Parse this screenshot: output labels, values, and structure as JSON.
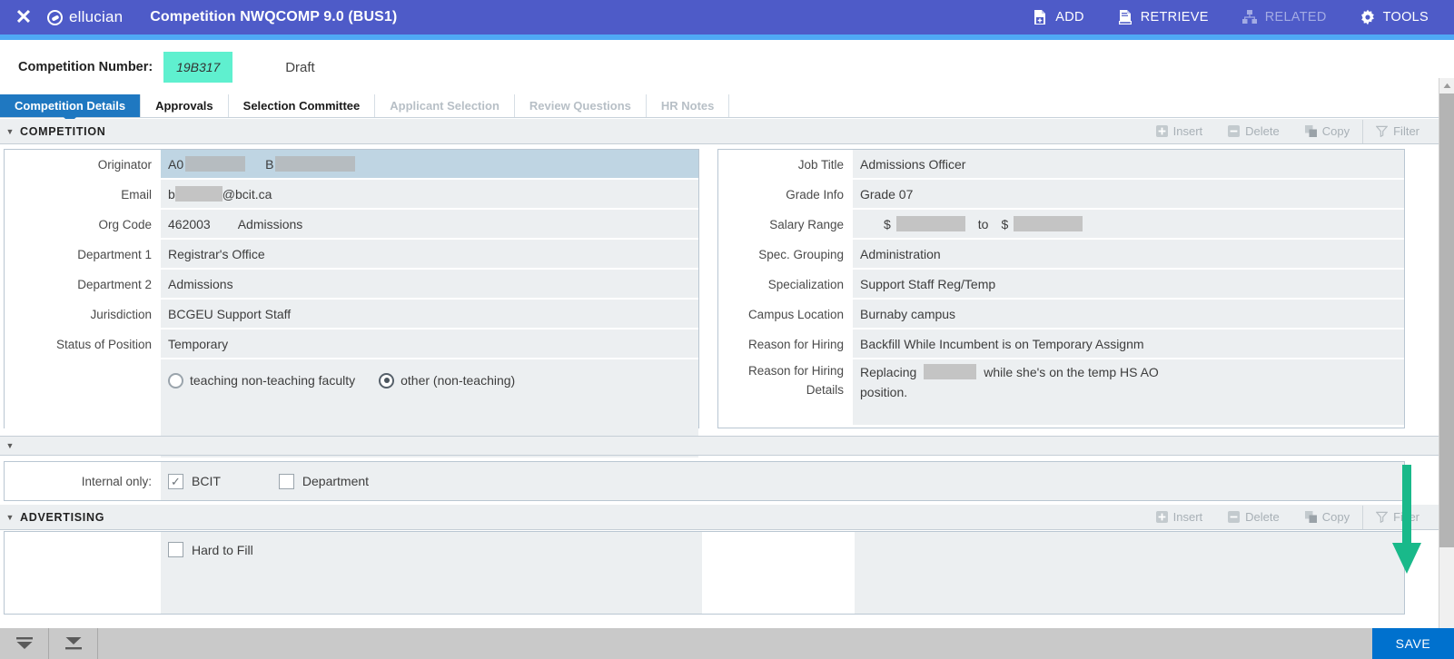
{
  "header": {
    "close_icon": "close-icon",
    "brand": "ellucian",
    "title": "Competition NWQCOMP 9.0 (BUS1)",
    "actions": [
      {
        "label": "ADD",
        "icon": "add-document-icon",
        "disabled": false
      },
      {
        "label": "RETRIEVE",
        "icon": "retrieve-document-icon",
        "disabled": false
      },
      {
        "label": "RELATED",
        "icon": "related-hierarchy-icon",
        "disabled": true
      },
      {
        "label": "TOOLS",
        "icon": "gear-icon",
        "disabled": false
      }
    ],
    "accent_purple": "#4e5bc8",
    "accent_blue": "#4fa8f5"
  },
  "key_block": {
    "label": "Competition Number:",
    "value": "19B317",
    "value_bg": "#5ff0cf",
    "status": "Draft"
  },
  "tabs": [
    {
      "label": "Competition Details",
      "active": true,
      "disabled": false
    },
    {
      "label": "Approvals",
      "active": false,
      "disabled": false
    },
    {
      "label": "Selection Committee",
      "active": false,
      "disabled": false
    },
    {
      "label": "Applicant Selection",
      "active": false,
      "disabled": true
    },
    {
      "label": "Review Questions",
      "active": false,
      "disabled": true
    },
    {
      "label": "HR Notes",
      "active": false,
      "disabled": true
    }
  ],
  "section_tools": {
    "insert": "Insert",
    "delete": "Delete",
    "copy": "Copy",
    "filter": "Filter"
  },
  "competition": {
    "section_title": "COMPETITION",
    "left_fields": [
      {
        "label": "Originator",
        "value": "A0",
        "type": "redacted-pair",
        "redact1_w": 66,
        "value2": "B",
        "redact2_w": 88,
        "active": true
      },
      {
        "label": "Email",
        "value": "b",
        "type": "redacted-email",
        "redact1_w": 52,
        "suffix": "@bcit.ca",
        "active": false
      },
      {
        "label": "Org Code",
        "value": "462003",
        "type": "pair",
        "value2": "Admissions",
        "active": false
      },
      {
        "label": "Department 1",
        "value": "Registrar's Office",
        "type": "text",
        "active": false
      },
      {
        "label": "Department 2",
        "value": "Admissions",
        "type": "text",
        "active": false
      },
      {
        "label": "Jurisdiction",
        "value": "BCGEU Support Staff",
        "type": "text",
        "active": false
      },
      {
        "label": "Status of Position",
        "value": "Temporary",
        "type": "text",
        "active": false
      }
    ],
    "radios": [
      {
        "label": "teaching non-teaching faculty",
        "selected": false
      },
      {
        "label": "other (non-teaching)",
        "selected": true
      }
    ],
    "right_fields": [
      {
        "label": "Job Title",
        "value": "Admissions Officer",
        "type": "text",
        "active": false
      },
      {
        "label": "Grade Info",
        "value": "Grade 07",
        "type": "text",
        "active": false
      },
      {
        "label": "Salary Range",
        "value": "",
        "type": "salary",
        "currency": "$",
        "redact1_w": 76,
        "joiner": "to",
        "currency2": "$",
        "redact2_w": 76,
        "active": false
      },
      {
        "label": "Spec. Grouping",
        "value": "Administration",
        "type": "text",
        "active": false
      },
      {
        "label": "Specialization",
        "value": "Support Staff Reg/Temp",
        "type": "text",
        "active": false
      },
      {
        "label": "Campus Location",
        "value": "Burnaby campus",
        "type": "text",
        "active": false
      },
      {
        "label": "Reason for Hiring",
        "value": "Backfill While Incumbent is on Temporary Assignm",
        "type": "text",
        "active": false
      },
      {
        "label": "Reason for Hiring",
        "label2": "Details",
        "value": "Replacing",
        "type": "redacted-sentence",
        "redact1_w": 58,
        "suffix": "while she's on the temp HS AO",
        "line2": "position.",
        "active": false
      }
    ]
  },
  "internal_only": {
    "label": "Internal only:",
    "checkboxes": [
      {
        "label": "BCIT",
        "checked": true
      },
      {
        "label": "Department",
        "checked": false
      }
    ]
  },
  "advertising": {
    "section_title": "ADVERTISING",
    "checkboxes": [
      {
        "label": "Hard to Fill",
        "checked": false
      }
    ]
  },
  "bottom_bar": {
    "first_icon": "go-to-first-icon",
    "last_icon": "go-to-last-icon",
    "save_label": "SAVE",
    "save_color": "#0071ce"
  },
  "annotation": {
    "arrow_color": "#19b98a",
    "direction": "down"
  }
}
